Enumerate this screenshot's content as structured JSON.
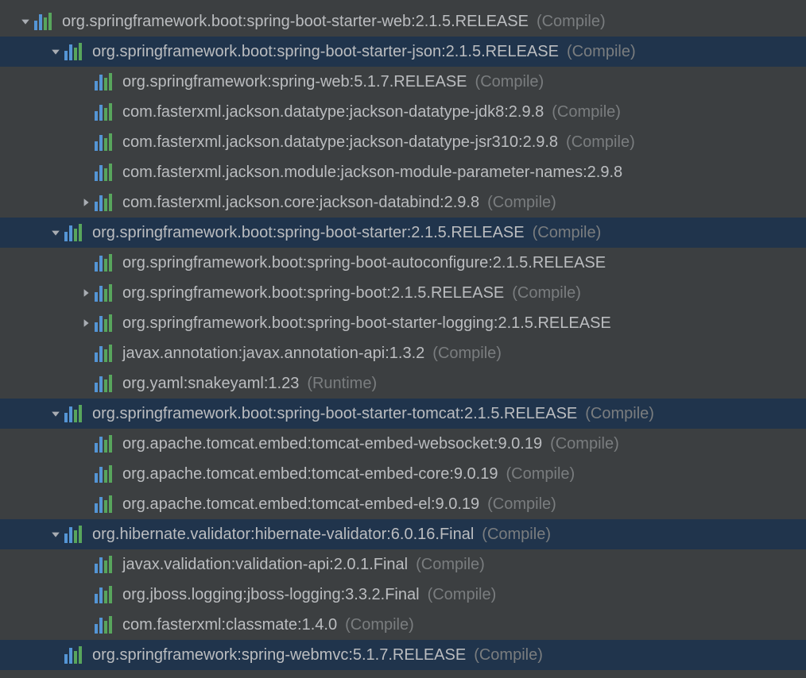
{
  "rows": [
    {
      "indent": 22,
      "arrow": "down",
      "selected": false,
      "label": "org.springframework.boot:spring-boot-starter-web:2.1.5.RELEASE",
      "scope": "(Compile)"
    },
    {
      "indent": 60,
      "arrow": "down",
      "selected": true,
      "label": "org.springframework.boot:spring-boot-starter-json:2.1.5.RELEASE",
      "scope": "(Compile)"
    },
    {
      "indent": 118,
      "arrow": "none",
      "selected": false,
      "label": "org.springframework:spring-web:5.1.7.RELEASE",
      "scope": "(Compile)"
    },
    {
      "indent": 118,
      "arrow": "none",
      "selected": false,
      "label": "com.fasterxml.jackson.datatype:jackson-datatype-jdk8:2.9.8",
      "scope": "(Compile)"
    },
    {
      "indent": 118,
      "arrow": "none",
      "selected": false,
      "label": "com.fasterxml.jackson.datatype:jackson-datatype-jsr310:2.9.8",
      "scope": "(Compile)"
    },
    {
      "indent": 118,
      "arrow": "none",
      "selected": false,
      "label": "com.fasterxml.jackson.module:jackson-module-parameter-names:2.9.8",
      "scope": ""
    },
    {
      "indent": 98,
      "arrow": "right",
      "selected": false,
      "label": "com.fasterxml.jackson.core:jackson-databind:2.9.8",
      "scope": "(Compile)"
    },
    {
      "indent": 60,
      "arrow": "down",
      "selected": true,
      "label": "org.springframework.boot:spring-boot-starter:2.1.5.RELEASE",
      "scope": "(Compile)"
    },
    {
      "indent": 118,
      "arrow": "none",
      "selected": false,
      "label": "org.springframework.boot:spring-boot-autoconfigure:2.1.5.RELEASE",
      "scope": ""
    },
    {
      "indent": 98,
      "arrow": "right",
      "selected": false,
      "label": "org.springframework.boot:spring-boot:2.1.5.RELEASE",
      "scope": "(Compile)"
    },
    {
      "indent": 98,
      "arrow": "right",
      "selected": false,
      "label": "org.springframework.boot:spring-boot-starter-logging:2.1.5.RELEASE",
      "scope": ""
    },
    {
      "indent": 118,
      "arrow": "none",
      "selected": false,
      "label": "javax.annotation:javax.annotation-api:1.3.2",
      "scope": "(Compile)"
    },
    {
      "indent": 118,
      "arrow": "none",
      "selected": false,
      "label": "org.yaml:snakeyaml:1.23",
      "scope": "(Runtime)"
    },
    {
      "indent": 60,
      "arrow": "down",
      "selected": true,
      "label": "org.springframework.boot:spring-boot-starter-tomcat:2.1.5.RELEASE",
      "scope": "(Compile)"
    },
    {
      "indent": 118,
      "arrow": "none",
      "selected": false,
      "label": "org.apache.tomcat.embed:tomcat-embed-websocket:9.0.19",
      "scope": "(Compile)"
    },
    {
      "indent": 118,
      "arrow": "none",
      "selected": false,
      "label": "org.apache.tomcat.embed:tomcat-embed-core:9.0.19",
      "scope": "(Compile)"
    },
    {
      "indent": 118,
      "arrow": "none",
      "selected": false,
      "label": "org.apache.tomcat.embed:tomcat-embed-el:9.0.19",
      "scope": "(Compile)"
    },
    {
      "indent": 60,
      "arrow": "down",
      "selected": true,
      "label": "org.hibernate.validator:hibernate-validator:6.0.16.Final",
      "scope": "(Compile)"
    },
    {
      "indent": 118,
      "arrow": "none",
      "selected": false,
      "label": "javax.validation:validation-api:2.0.1.Final",
      "scope": "(Compile)"
    },
    {
      "indent": 118,
      "arrow": "none",
      "selected": false,
      "label": "org.jboss.logging:jboss-logging:3.3.2.Final",
      "scope": "(Compile)"
    },
    {
      "indent": 118,
      "arrow": "none",
      "selected": false,
      "label": "com.fasterxml:classmate:1.4.0",
      "scope": "(Compile)"
    },
    {
      "indent": 80,
      "arrow": "none",
      "selected": true,
      "label": "org.springframework:spring-webmvc:5.1.7.RELEASE",
      "scope": "(Compile)"
    }
  ]
}
